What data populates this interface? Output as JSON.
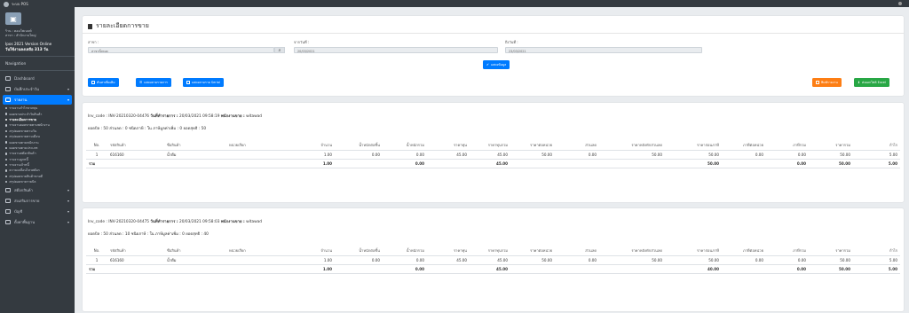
{
  "topbar": {
    "brand": "ระบบ POS",
    "user_icon": "user-icon"
  },
  "sidebar": {
    "shop_label": "ร้าน : คอมโพเนนท์",
    "branch_label": "สาขา : สำนักงานใหญ่",
    "version": "Ipos 2021 Version Online",
    "days_left": "วันใช้งานคงเหลือ 313 วัน",
    "nav_header": "Navigation",
    "items": [
      {
        "label": "Dashboard",
        "icon": "dashboard-icon"
      },
      {
        "label": "บันทึกประจำวัน",
        "icon": "calendar-icon"
      },
      {
        "label": "รายงาน",
        "icon": "report-icon"
      }
    ],
    "subitems": [
      "รายงานกำไรขาดทุน",
      "ยอดขายประจำวันสินค้า",
      "รายละเอียดการขาย",
      "รายงานยอดขายตามพนักงาน",
      "สรุปยอดขายตามวัน",
      "สรุปยอดขายตามเดือน",
      "ยอดขายตามพนักงาน",
      "ยอดขายตามประเภท",
      "รายงานสต๊อกสินค้า",
      "รายงานลูกหนี้",
      "รายงานเจ้าหนี้",
      "ความเคลื่อนไหวสต๊อก",
      "สรุปยอดขายสินค้าขายดี",
      "สรุปยอดขายรายบิล"
    ],
    "bottom_items": [
      {
        "label": "สต๊อกสินค้า",
        "icon": "box-icon"
      },
      {
        "label": "ส่งเสริมการขาย",
        "icon": "tag-icon"
      },
      {
        "label": "บัญชี",
        "icon": "book-icon"
      },
      {
        "label": "ตั้งค่าพื้นฐาน",
        "icon": "gear-icon"
      }
    ]
  },
  "filter": {
    "title": "รายละเอียดการขาย",
    "branch_label": "สาขา :",
    "branch_value": "สาขาทั้งหมด",
    "from_label": "จากวันที่ :",
    "from_value": "20/03/2021",
    "to_label": "ถึงวันที่ :",
    "to_value": "23/03/2021",
    "search_button": "แสดงข้อมูล",
    "btn_detail": "ค้นหาเพิ่มเติม",
    "btn_list": "แสดงตามรายการ",
    "btn_list_serial": "แสดงตามราย Serial",
    "btn_print": "พิมพ์รายงาน",
    "btn_excel": "ส่งออกไฟล์ Excel"
  },
  "columns": [
    "No.",
    "รหัสสินค้า",
    "ชื่อสินค้า",
    "หน่วยเรียก",
    "จำนวน",
    "น้ำหนักต่อชิ้น",
    "น้ำหนักรวม",
    "ราคาทุน",
    "ราคาทุนรวม",
    "ราคาต่อหน่วย",
    "ส่วนลด",
    "ราคาหลังหักส่วนลด",
    "ราคาก่อนภาษี",
    "ภาษีต่อหน่วย",
    "ภาษีรวม",
    "ราคารวม",
    "กำไร"
  ],
  "invoices": [
    {
      "inv_label": "Inv_code :",
      "inv_code": "INV-20210320-04476",
      "date_label": "วันที่ทำรายการ :",
      "date": "20/03/2021 09:58:19",
      "staff_label": "พนักงานขาย :",
      "staff": "witawad",
      "summary": "ยอดบิล : 50 ส่วนลด : 0 ชนิดภาษี : ใน ภาษีมูลค่าเพิ่ม : 0 ยอดสุทธิ : 50",
      "rows": [
        [
          "1",
          "616160",
          "น้ำดื่ม",
          "",
          "1.00",
          "0.00",
          "0.00",
          "45.00",
          "45.00",
          "50.00",
          "0.00",
          "50.00",
          "50.00",
          "0.00",
          "0.00",
          "50.00",
          "5.00"
        ]
      ],
      "total": [
        "รวม",
        "",
        "",
        "",
        "1.00",
        "",
        "0.00",
        "",
        "45.00",
        "",
        "",
        "",
        "50.00",
        "",
        "0.00",
        "50.00",
        "5.00"
      ]
    },
    {
      "inv_label": "Inv_code :",
      "inv_code": "INV-20210320-04475",
      "date_label": "วันที่ทำรายการ :",
      "date": "20/03/2021 09:58:03",
      "staff_label": "พนักงานขาย :",
      "staff": "witawad",
      "summary": "ยอดบิล : 50 ส่วนลด : 10 ชนิดภาษี : ใน ภาษีมูลค่าเพิ่ม : 0 ยอดสุทธิ : 40",
      "rows": [
        [
          "1",
          "616160",
          "น้ำดื่ม",
          "",
          "1.00",
          "0.00",
          "0.00",
          "45.00",
          "45.00",
          "50.00",
          "0.00",
          "50.00",
          "50.00",
          "0.00",
          "0.00",
          "50.00",
          "5.00"
        ]
      ],
      "total": [
        "รวม",
        "",
        "",
        "",
        "1.00",
        "",
        "0.00",
        "",
        "45.00",
        "",
        "",
        "",
        "40.00",
        "",
        "0.00",
        "50.00",
        "5.00"
      ]
    }
  ]
}
